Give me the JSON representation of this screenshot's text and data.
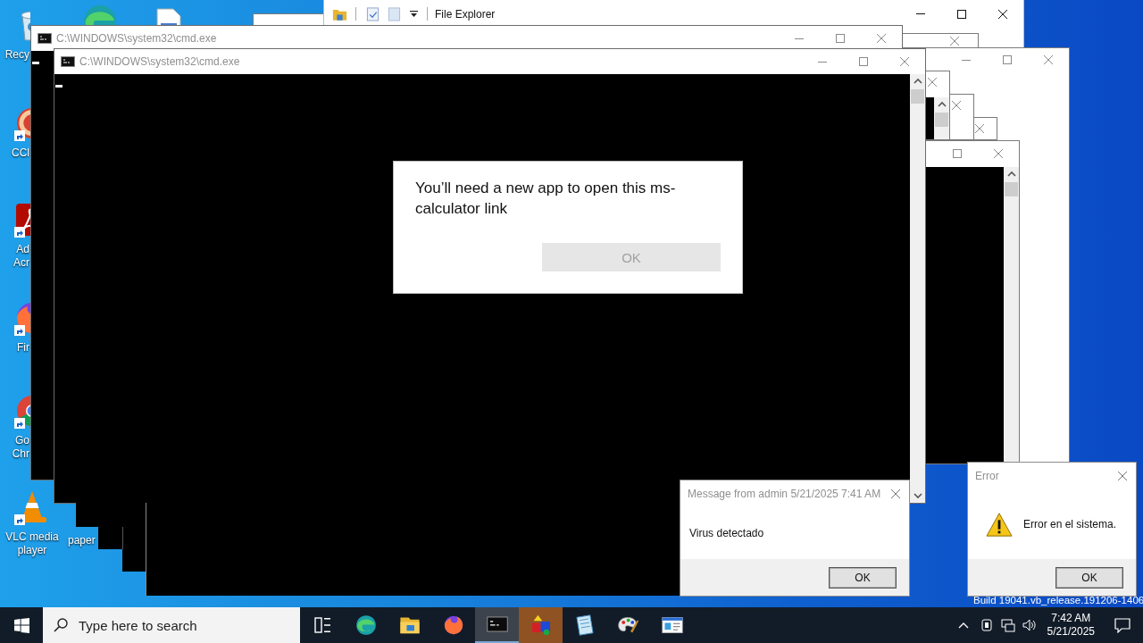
{
  "desktop": {
    "icons": [
      {
        "kind": "recycle-bin",
        "label": "Recy",
        "shortcut": false
      },
      {
        "kind": "edge",
        "shortcut": false
      },
      {
        "kind": "document",
        "shortcut": false
      },
      {
        "kind": "ccleaner",
        "label": "CCl",
        "shortcut": true
      },
      {
        "kind": "acrobat",
        "label": "Ad Acr",
        "shortcut": true
      },
      {
        "kind": "firefox",
        "label": "Fir",
        "shortcut": true
      },
      {
        "kind": "chrome",
        "label": "Go Chr",
        "shortcut": true
      },
      {
        "kind": "vlc",
        "label": "VLC media player",
        "shortcut": true
      },
      {
        "label": "paper"
      }
    ],
    "build_text": "Build 19041.vb_release.191206-1406"
  },
  "windows": [
    {
      "kind": "explorer",
      "title": "File Explorer"
    },
    {
      "kind": "console",
      "title": "C:\\WINDOWS\\system32\\cmd.exe"
    },
    {
      "kind": "console",
      "title": "C:\\WINDOWS\\system32\\cmd.exe"
    }
  ],
  "dialogs": [
    {
      "kind": "app-prompt",
      "message": "You’ll need a new app to open this ms-calculator link",
      "button": {
        "label": "OK",
        "disabled": true
      }
    },
    {
      "kind": "message",
      "title": "Message from admin 5/21/2025 7:41 AM",
      "message": "Virus detectado",
      "button": {
        "label": "OK",
        "disabled": false
      }
    },
    {
      "kind": "error",
      "title": "Error",
      "message": "Error en el sistema.",
      "button": {
        "label": "OK",
        "disabled": false
      }
    }
  ],
  "taskbar": {
    "search": {
      "placeholder": "Type here to search"
    },
    "apps": [
      {
        "kind": "task-view",
        "active": false,
        "flashing": false
      },
      {
        "kind": "edge",
        "active": false,
        "flashing": false
      },
      {
        "kind": "explorer",
        "active": false,
        "flashing": false
      },
      {
        "kind": "firefox",
        "active": false,
        "flashing": false
      },
      {
        "kind": "console",
        "active": true,
        "flashing": false
      },
      {
        "kind": "shapes",
        "active": false,
        "flashing": true
      },
      {
        "kind": "notebook",
        "active": false,
        "flashing": false
      },
      {
        "kind": "palette",
        "active": false,
        "flashing": false
      },
      {
        "kind": "window",
        "active": false,
        "flashing": false
      }
    ],
    "clock": {
      "time": "7:42 AM",
      "date": "5/21/2025"
    }
  }
}
